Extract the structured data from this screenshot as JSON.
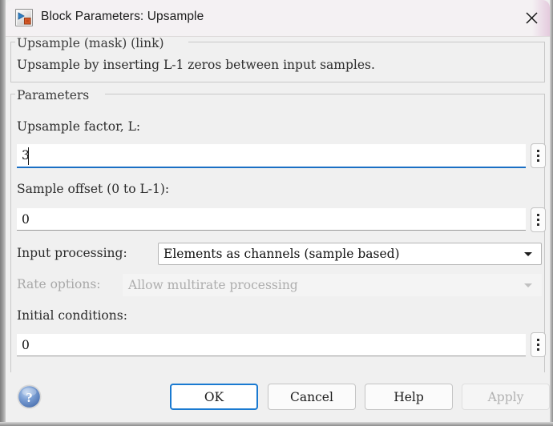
{
  "window": {
    "title": "Block Parameters: Upsample",
    "icon": "simulink-block-icon",
    "close_icon": "close-icon"
  },
  "description": {
    "group_title": "Upsample (mask) (link)",
    "text": "Upsample by inserting L-1 zeros between input samples."
  },
  "parameters": {
    "group_title": "Parameters",
    "fields": [
      {
        "name": "upsample-factor",
        "label": "Upsample factor, L:",
        "type": "text",
        "value": "3",
        "focused": true,
        "enabled": true,
        "has_kebab": true
      },
      {
        "name": "sample-offset",
        "label": "Sample offset (0 to L-1):",
        "type": "text",
        "value": "0",
        "focused": false,
        "enabled": true,
        "has_kebab": true
      },
      {
        "name": "input-processing",
        "label": "Input processing:",
        "type": "combo",
        "value": "Elements as channels (sample based)",
        "enabled": true
      },
      {
        "name": "rate-options",
        "label": "Rate options:",
        "type": "combo",
        "value": "Allow multirate processing",
        "enabled": false
      },
      {
        "name": "initial-conditions",
        "label": "Initial conditions:",
        "type": "text",
        "value": "0",
        "focused": false,
        "enabled": true,
        "has_kebab": true
      }
    ]
  },
  "footer": {
    "help_icon": "help-question-icon",
    "buttons": [
      {
        "name": "ok-button",
        "label": "OK",
        "default": true,
        "enabled": true
      },
      {
        "name": "cancel-button",
        "label": "Cancel",
        "default": false,
        "enabled": true
      },
      {
        "name": "help-button",
        "label": "Help",
        "default": false,
        "enabled": true
      },
      {
        "name": "apply-button",
        "label": "Apply",
        "default": false,
        "enabled": false
      }
    ]
  },
  "colors": {
    "accent": "#1a7ad1",
    "focus_underline": "#1a6fc4",
    "dialog_bg": "#f0f0f0",
    "titlebar_bg": "#f4f1f3"
  }
}
